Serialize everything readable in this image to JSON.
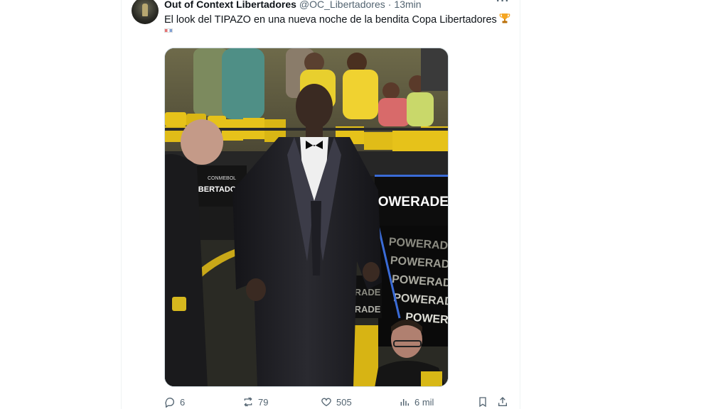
{
  "tweet": {
    "author_name": "Out of Context Libertadores",
    "author_handle": "@OC_Libertadores",
    "separator": "·",
    "time": "13min",
    "text": "El look del TIPAZO en una nueva noche de la bendita Copa Libertadores",
    "emoji_icon": "trophy-icon",
    "more_label": "···"
  },
  "media": {
    "description_icon": "photo",
    "signage": {
      "sponsor_main": "POWERADE",
      "sponsor_repeat": [
        "POWERADE",
        "POWERADE",
        "POWERADE",
        "POWERADE",
        "POWER"
      ],
      "left_board_small": "CONMEBOL",
      "left_board": "LIBERTADORES",
      "bottom_board": [
        "RADE",
        "RADE"
      ]
    },
    "colors": {
      "stand_yellow": "#e6c21a",
      "suit": "#1e1e22",
      "board": "#111111"
    }
  },
  "actions": {
    "reply_count": "6",
    "retweet_count": "79",
    "like_count": "505",
    "views_count": "6 mil"
  }
}
